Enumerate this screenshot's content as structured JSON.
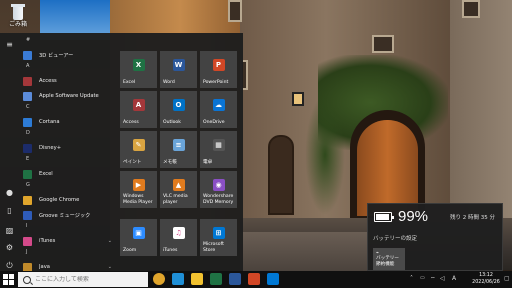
{
  "desktop": {
    "recycle_bin_label": "ごみ箱"
  },
  "start_menu": {
    "rail_icons": [
      "menu-icon",
      "user-icon",
      "document-icon",
      "picture-icon",
      "settings-icon",
      "power-icon"
    ],
    "apps": [
      {
        "type": "letter",
        "text": "#"
      },
      {
        "type": "app",
        "name": "3D ビューアー",
        "color": "#3a7bd5"
      },
      {
        "type": "letter",
        "text": "A"
      },
      {
        "type": "app",
        "name": "Access",
        "color": "#a4373a"
      },
      {
        "type": "app",
        "name": "Apple Software Update",
        "color": "#5b8bd9"
      },
      {
        "type": "letter",
        "text": "C"
      },
      {
        "type": "app",
        "name": "Cortana",
        "color": "#2d7bd6"
      },
      {
        "type": "letter",
        "text": "D"
      },
      {
        "type": "app",
        "name": "Disney+",
        "color": "#1c2c6b"
      },
      {
        "type": "letter",
        "text": "E"
      },
      {
        "type": "app",
        "name": "Excel",
        "color": "#1f7244"
      },
      {
        "type": "letter",
        "text": "G"
      },
      {
        "type": "app",
        "name": "Google Chrome",
        "color": "#e0a52c"
      },
      {
        "type": "app",
        "name": "Groove ミュージック",
        "color": "#2e5bb8"
      },
      {
        "type": "letter",
        "text": "I"
      },
      {
        "type": "app",
        "name": "iTunes",
        "color": "#d44a8a",
        "chevron": "⌄"
      },
      {
        "type": "letter",
        "text": "J"
      },
      {
        "type": "app",
        "name": "Java",
        "color": "#c08a2a",
        "chevron": "⌄"
      }
    ],
    "tiles": [
      {
        "label": "Excel",
        "icon": "excel-icon",
        "glyph": "X",
        "color": "#1f7244"
      },
      {
        "label": "Word",
        "icon": "word-icon",
        "glyph": "W",
        "color": "#2b579a"
      },
      {
        "label": "PowerPoint",
        "icon": "powerpoint-icon",
        "glyph": "P",
        "color": "#d24726"
      },
      {
        "label": "Access",
        "icon": "access-icon",
        "glyph": "A",
        "color": "#a4373a"
      },
      {
        "label": "Outlook",
        "icon": "outlook-icon",
        "glyph": "O",
        "color": "#0072c6"
      },
      {
        "label": "OneDrive",
        "icon": "onedrive-icon",
        "glyph": "☁",
        "color": "#0a74d4"
      },
      {
        "label": "ペイント",
        "icon": "paint-icon",
        "glyph": "✎",
        "color": "#d9a441"
      },
      {
        "label": "メモ帳",
        "icon": "notepad-icon",
        "glyph": "≡",
        "color": "#6aa4d8"
      },
      {
        "label": "電卓",
        "icon": "calculator-icon",
        "glyph": "▦",
        "color": "#555555"
      },
      {
        "label": "Windows\nMedia Player",
        "icon": "media-player-icon",
        "glyph": "▶",
        "color": "#e07b1e"
      },
      {
        "label": "VLC media\nplayer",
        "icon": "vlc-icon",
        "glyph": "▲",
        "color": "#e07b1e"
      },
      {
        "label": "Wondershare\nDVD Memory",
        "icon": "dvd-memory-icon",
        "glyph": "◉",
        "color": "#8a4fc4"
      },
      {
        "label": "Zoom",
        "icon": "zoom-icon",
        "glyph": "▣",
        "color": "#2d8cff"
      },
      {
        "label": "iTunes",
        "icon": "itunes-icon",
        "glyph": "♫",
        "color": "#ffffff"
      },
      {
        "label": "Microsoft Store",
        "icon": "store-icon",
        "glyph": "⊞",
        "color": "#0078d4"
      }
    ]
  },
  "battery": {
    "level_fraction": 0.99,
    "percent_text": "99%",
    "remaining_text": "残り 2 時間 35 分",
    "settings_label": "バッテリーの設定",
    "saver_label": "バッテリー\n節約機能"
  },
  "taskbar": {
    "search_placeholder": "ここに入力して検索",
    "pinned_apps": [
      {
        "name": "chrome-icon",
        "color": "#e0a52c"
      },
      {
        "name": "edge-icon",
        "color": "#1f8fd6"
      },
      {
        "name": "file-explorer-icon",
        "color": "#f2c230"
      },
      {
        "name": "excel-icon",
        "color": "#1f7244"
      },
      {
        "name": "word-icon",
        "color": "#2b579a"
      },
      {
        "name": "powerpoint-icon",
        "color": "#d24726"
      },
      {
        "name": "store-icon",
        "color": "#0078d4"
      }
    ],
    "ime_label": "A",
    "clock_time": "13:12",
    "clock_date": "2022/06/26"
  }
}
